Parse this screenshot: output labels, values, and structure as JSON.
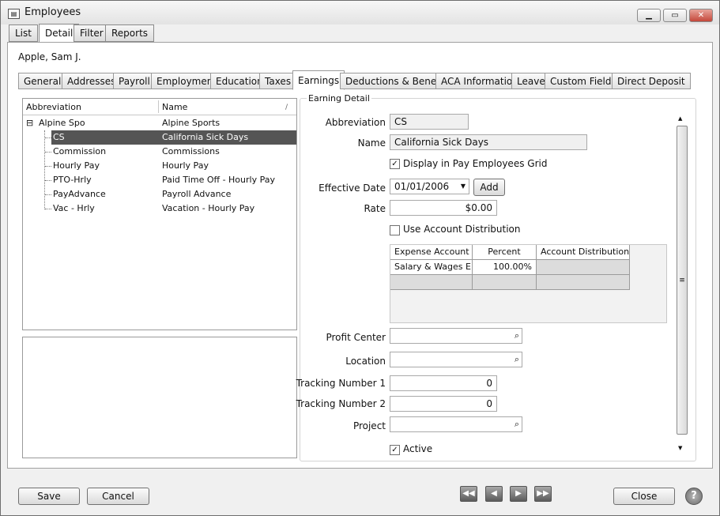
{
  "window": {
    "title": "Employees"
  },
  "top_tabs": [
    "List",
    "Detail",
    "Filter",
    "Reports"
  ],
  "employee_name": "Apple, Sam J.",
  "sub_tabs": [
    "General",
    "Addresses",
    "Payroll",
    "Employment",
    "Education",
    "Taxes",
    "Earnings",
    "Deductions & Benefits",
    "ACA Information",
    "Leave",
    "Custom Fields",
    "Direct Deposit"
  ],
  "tree": {
    "headers": {
      "abbreviation": "Abbreviation",
      "name": "Name"
    },
    "root": {
      "abbr": "Alpine Spo",
      "name": "Alpine Sports",
      "expander": "⊟"
    },
    "items": [
      {
        "abbr": "CS",
        "name": "California Sick Days"
      },
      {
        "abbr": "Commission",
        "name": "Commissions"
      },
      {
        "abbr": "Hourly Pay",
        "name": "Hourly Pay"
      },
      {
        "abbr": "PTO-Hrly",
        "name": "Paid Time Off - Hourly Pay"
      },
      {
        "abbr": "PayAdvance",
        "name": "Payroll Advance"
      },
      {
        "abbr": "Vac - Hrly",
        "name": "Vacation - Hourly Pay"
      }
    ]
  },
  "detail": {
    "group_title": "Earning Detail",
    "abbreviation_label": "Abbreviation",
    "abbreviation": "CS",
    "name_label": "Name",
    "name": "California Sick Days",
    "display_grid_label": "Display in Pay Employees Grid",
    "effective_date_label": "Effective Date",
    "effective_date": "01/01/2006",
    "add_label": "Add",
    "rate_label": "Rate",
    "rate": "$0.00",
    "use_account_dist_label": "Use Account Distribution",
    "grid": {
      "headers": [
        "Expense Account",
        "Percent",
        "Account Distribution"
      ],
      "rows": [
        [
          "Salary & Wages E",
          "100.00%",
          ""
        ]
      ]
    },
    "profit_center_label": "Profit Center",
    "profit_center": "",
    "location_label": "Location",
    "location": "",
    "tracking1_label": "Tracking Number 1",
    "tracking1": "0",
    "tracking2_label": "Tracking Number 2",
    "tracking2": "0",
    "project_label": "Project",
    "project": "",
    "active_label": "Active"
  },
  "footer": {
    "save": "Save",
    "cancel": "Cancel",
    "close": "Close",
    "help": "?"
  }
}
